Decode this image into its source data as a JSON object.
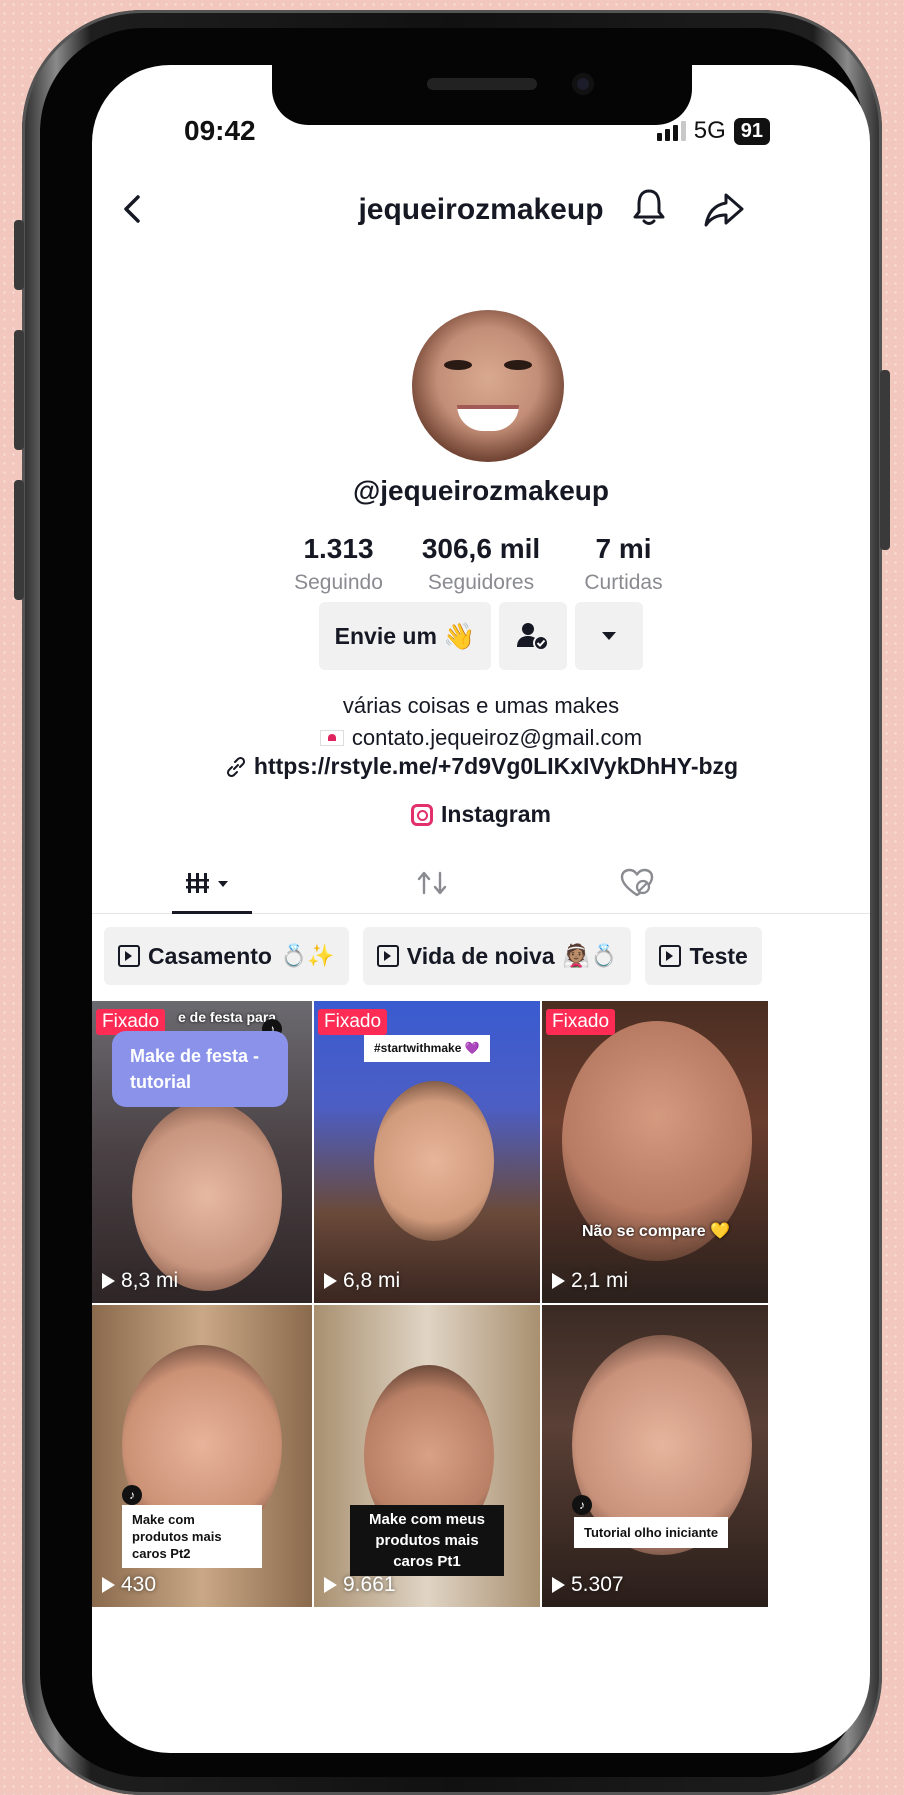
{
  "status": {
    "time": "09:42",
    "network": "5G",
    "battery": "91"
  },
  "header": {
    "title": "jequeirozmakeup"
  },
  "profile": {
    "handle": "@jequeirozmakeup",
    "stats": [
      {
        "value": "1.313",
        "label": "Seguindo"
      },
      {
        "value": "306,6 mil",
        "label": "Seguidores"
      },
      {
        "value": "7 mi",
        "label": "Curtidas"
      }
    ],
    "message_label": "Envie um",
    "message_emoji": "👋",
    "bio_line1": "várias coisas e umas makes",
    "bio_email": "contato.jequeiroz@gmail.com",
    "link": "https://rstyle.me/+7d9Vg0LIKxIVykDhHY-bzg",
    "instagram": "Instagram"
  },
  "playlists": [
    {
      "label": "Casamento",
      "emoji": "💍✨"
    },
    {
      "label": "Vida de noiva",
      "emoji": "👰🏽💍"
    },
    {
      "label": "Teste",
      "emoji": ""
    }
  ],
  "videos": [
    {
      "pinned": "Fixado",
      "views": "8,3 mi",
      "caption_top": "e de festa para",
      "caption": "Make de festa - tutorial"
    },
    {
      "pinned": "Fixado",
      "views": "6,8 mi",
      "caption": "#startwithmake 💜"
    },
    {
      "pinned": "Fixado",
      "views": "2,1 mi",
      "caption": "Não se compare 💛"
    },
    {
      "views": "430",
      "caption": "Make com produtos mais caros Pt2"
    },
    {
      "views": "9.661",
      "caption": "Make com meus produtos mais caros Pt1"
    },
    {
      "views": "5.307",
      "caption": "Tutorial olho iniciante"
    }
  ],
  "colors": {
    "pinned": "#fe2c55",
    "chip_bg": "#f1f1f2",
    "text": "#161823",
    "secondary": "#8a8b91"
  }
}
